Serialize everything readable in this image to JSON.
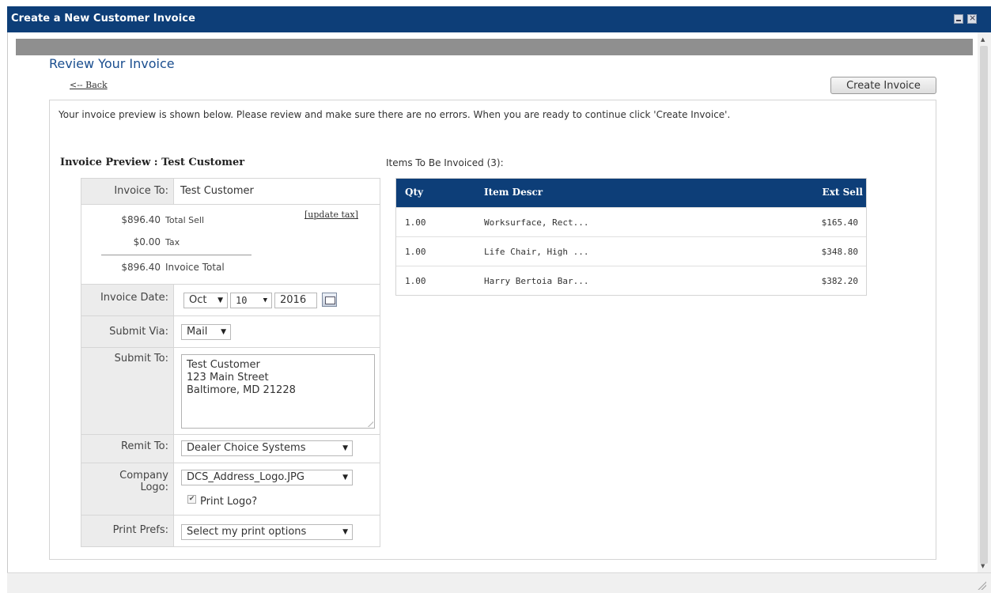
{
  "window": {
    "title": "Create a New Customer Invoice"
  },
  "page": {
    "title": "Review Your Invoice",
    "back_label": "<-- Back",
    "create_button": "Create Invoice",
    "intro": "Your invoice preview is shown below. Please review and make sure there are no errors. When you are ready to continue click 'Create Invoice'."
  },
  "preview": {
    "heading": "Invoice Preview : Test Customer",
    "invoice_to_label": "Invoice To:",
    "invoice_to_value": "Test Customer",
    "update_tax": "[update tax]",
    "total_sell_amount": "$896.40",
    "total_sell_label": "Total Sell",
    "tax_amount": "$0.00",
    "tax_label": "Tax",
    "invoice_total_amount": "$896.40",
    "invoice_total_label": "Invoice Total",
    "invoice_date_label": "Invoice Date:",
    "date_month": "Oct",
    "date_day": "10",
    "date_year": "2016",
    "submit_via_label": "Submit Via:",
    "submit_via_value": "Mail",
    "submit_to_label": "Submit To:",
    "submit_to_value": "Test Customer\n123 Main Street\nBaltimore, MD 21228",
    "remit_to_label": "Remit To:",
    "remit_to_value": "Dealer Choice Systems",
    "company_logo_label_1": "Company",
    "company_logo_label_2": "Logo:",
    "company_logo_value": "DCS_Address_Logo.JPG",
    "print_logo_label": "Print Logo?",
    "print_logo_checked": true,
    "print_prefs_label": "Print Prefs:",
    "print_prefs_value": "Select my print options"
  },
  "items": {
    "heading": "Items To Be Invoiced (3):",
    "columns": {
      "qty": "Qty",
      "descr": "Item Descr",
      "ext_sell": "Ext Sell"
    },
    "rows": [
      {
        "qty": "1.00",
        "descr": "Worksurface, Rect...",
        "ext_sell": "$165.40"
      },
      {
        "qty": "1.00",
        "descr": "Life Chair, High ...",
        "ext_sell": "$348.80"
      },
      {
        "qty": "1.00",
        "descr": "Harry Bertoia Bar...",
        "ext_sell": "$382.20"
      }
    ]
  },
  "colors": {
    "titlebar": "#0d3e78",
    "title_text": "#1a4e8f",
    "header_bg": "#0d3e78"
  }
}
